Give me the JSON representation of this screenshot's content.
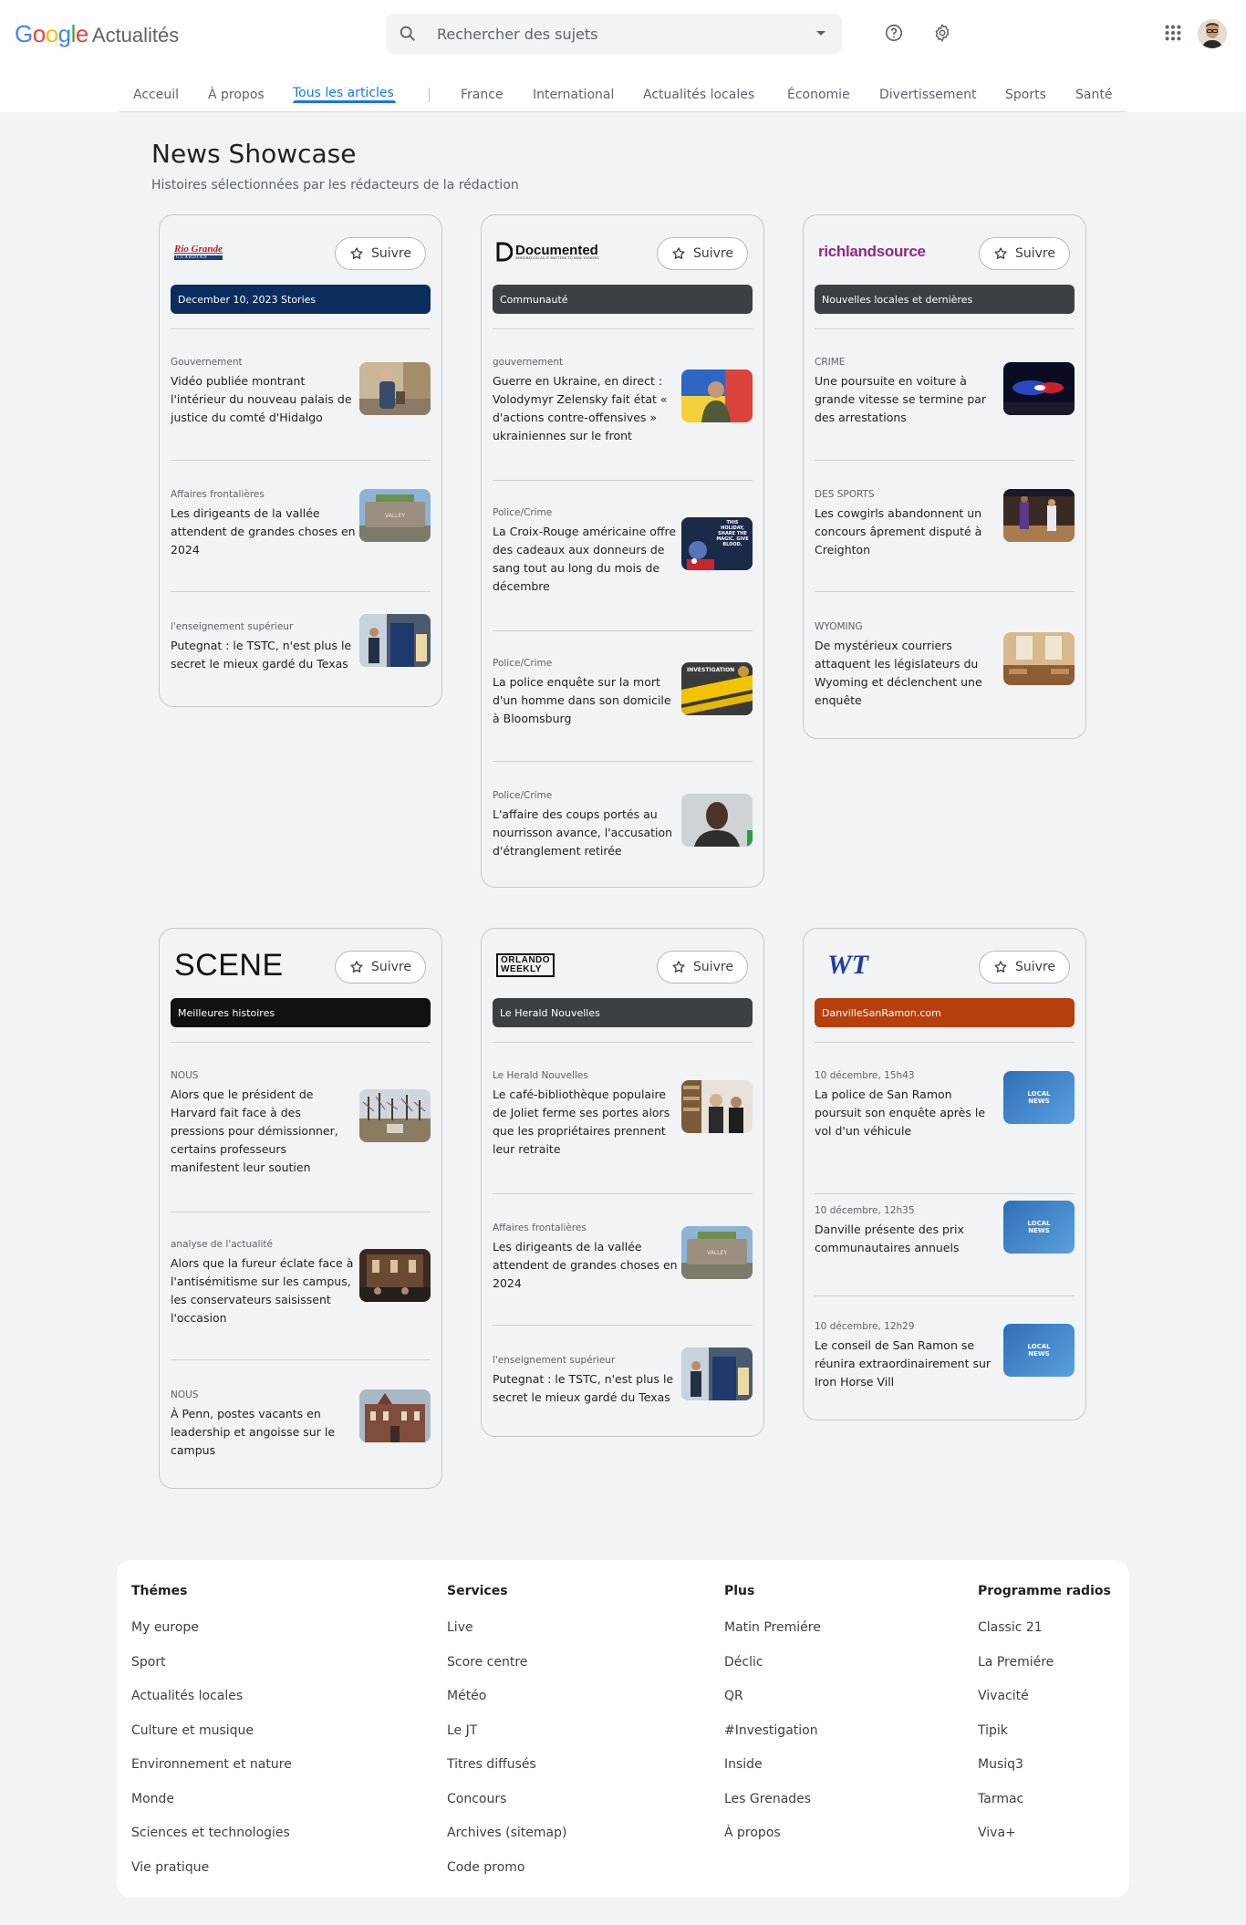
{
  "header": {
    "logo_text": "Google",
    "logo_word": "Actualités",
    "search_placeholder": "Rechercher des sujets",
    "help_icon": "help-circle-icon",
    "settings_icon": "gear-icon",
    "apps_icon": "apps-grid-icon"
  },
  "nav": {
    "items": [
      "Acceuil",
      "À propos",
      "Tous les articles",
      "France",
      "International",
      "Actualités locales",
      "Économie",
      "Divertissement",
      "Sports",
      "Santé"
    ],
    "active": "Tous les articles"
  },
  "main": {
    "title": "News Showcase",
    "subtitle": "Histoires sélectionnées par les rédacteurs de la rédaction",
    "follow_label": "Suivre",
    "cards": [
      {
        "logo": "Rio Grande",
        "logo_sub": "GUARDIAN",
        "banner": "December 10, 2023 Stories",
        "banner_color": "#0b2d5e",
        "articles": [
          {
            "category": "Gouvernement",
            "title": "Vidéo publiée montrant l'intérieur du nouveau palais de justice du comté d'Hidalgo"
          },
          {
            "category": "Affaires frontalières",
            "title": "Les dirigeants de la vallée attendent de grandes choses en 2024"
          },
          {
            "category": "l'enseignement supérieur",
            "title": "Putegnat : le TSTC, n'est plus le secret le mieux gardé du Texas"
          }
        ]
      },
      {
        "logo": "Documented",
        "logo_sub": "IMMIGRATION AS IT MATTERS TO NEW YORKERS",
        "banner": "Communauté",
        "banner_color": "#3c4043",
        "articles": [
          {
            "category": "gouvernement",
            "title": "Guerre en Ukraine, en direct : Volodymyr Zelensky fait état « d'actions contre-offensives » ukrainiennes sur le front"
          },
          {
            "category": "Police/Crime",
            "title": "La Croix-Rouge américaine offre des cadeaux aux donneurs de sang tout au long du mois de décembre",
            "thumb_text": "THIS HOLIDAY, SHARE THE MAGIC. GIVE BLOOD."
          },
          {
            "category": "Police/Crime",
            "title": "La police enquête sur la mort d'un homme dans son domicile à Bloomsburg",
            "thumb_text": "INVESTIGATION"
          },
          {
            "category": "Police/Crime",
            "title": "L'affaire des coups portés au nourrisson avance, l'accusation d'étranglement retirée"
          }
        ]
      },
      {
        "logo": "richlandsource",
        "banner": "Nouvelles locales et dernières",
        "banner_color": "#3c4043",
        "articles": [
          {
            "category": "CRIME",
            "title": "Une poursuite en voiture à grande vitesse se termine par des arrestations"
          },
          {
            "category": "DES SPORTS",
            "title": "Les cowgirls abandonnent un concours âprement disputé à Creighton"
          },
          {
            "category": "WYOMING",
            "title": "De mystérieux courriers attaquent les législateurs du Wyoming et déclenchent une enquête"
          }
        ]
      },
      {
        "logo": "SCENE",
        "banner": "Meilleures histoires",
        "banner_color": "#111111",
        "articles": [
          {
            "category": "NOUS",
            "title": "Alors que le président de Harvard fait face à des pressions pour démissionner, certains professeurs manifestent leur soutien"
          },
          {
            "category": "analyse de l'actualité",
            "title": "Alors que la fureur éclate face à l'antisémitisme sur les campus, les conservateurs saisissent l'occasion"
          },
          {
            "category": "NOUS",
            "title": "À Penn, postes vacants en leadership et angoisse sur le campus"
          }
        ]
      },
      {
        "logo": "ORLANDO",
        "logo_sub": "WEEKLY",
        "banner": "Le Herald Nouvelles",
        "banner_color": "#3c4043",
        "articles": [
          {
            "category": "Le Herald Nouvelles",
            "title": "Le café-bibliothèque populaire de Joliet ferme ses portes alors que les propriétaires prennent leur retraite"
          },
          {
            "category": "Affaires frontalières",
            "title": "Les dirigeants de la vallée attendent de grandes choses en 2024"
          },
          {
            "category": "l'enseignement supérieur",
            "title": "Putegnat : le TSTC, n'est plus le secret le mieux gardé du Texas"
          }
        ]
      },
      {
        "logo": "WT",
        "banner": "DanvilleSanRamon.com",
        "banner_color": "#b5400e",
        "articles": [
          {
            "category": "10 décembre, 15h43",
            "title": "La police de San Ramon poursuit son enquête après le vol d'un véhicule",
            "thumb_text": "LOCAL NEWS"
          },
          {
            "category": "10 décembre, 12h35",
            "title": "Danville présente des prix communautaires annuels",
            "thumb_text": "LOCAL NEWS"
          },
          {
            "category": "10 décembre, 12h29",
            "title": "Le conseil de San Ramon se réunira extraordinairement sur Iron Horse Vill",
            "thumb_text": "LOCAL NEWS"
          }
        ]
      }
    ]
  },
  "footer": {
    "columns": [
      {
        "heading": "Thémes",
        "links": [
          "My europe",
          "Sport",
          "Actualités locales",
          "Culture et musique",
          "Environnement et nature",
          "Monde",
          "Sciences et technologies",
          "Vie pratique"
        ]
      },
      {
        "heading": "Services",
        "links": [
          "Live",
          "Score centre",
          "Météo",
          "Le JT",
          "Titres diffusés",
          "Concours",
          "Archives (sitemap)",
          "Code promo"
        ]
      },
      {
        "heading": "Plus",
        "links": [
          "Matin Premiére",
          "Déclic",
          "QR",
          "#Investigation",
          "Inside",
          "Les Grenades",
          "À propos"
        ]
      },
      {
        "heading": "Programme radios",
        "links": [
          "Classic 21",
          "La Premiére",
          "Vivacité",
          "Tipik",
          "Musiq3",
          "Tarmac",
          "Viva+"
        ]
      }
    ]
  }
}
